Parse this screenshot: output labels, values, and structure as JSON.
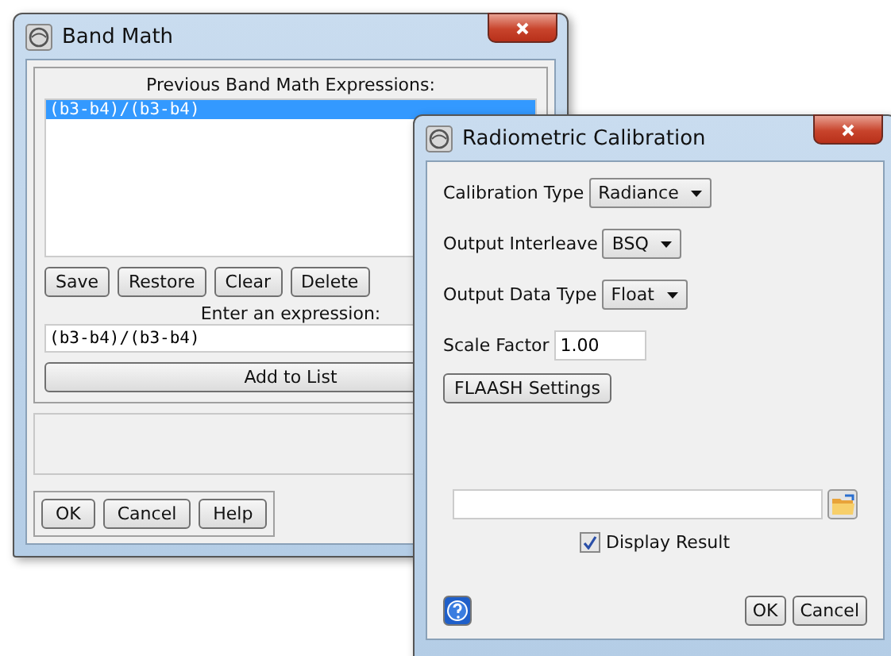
{
  "band_math": {
    "title": "Band Math",
    "list_label": "Previous Band Math Expressions:",
    "expressions": [
      {
        "text": "(b3-b4)/(b3-b4)",
        "selected": true
      }
    ],
    "list_buttons": [
      "Save",
      "Restore",
      "Clear",
      "Delete"
    ],
    "expression_label": "Enter an expression:",
    "expression_value": "(b3-b4)/(b3-b4)",
    "add_button": "Add to List",
    "buttons": [
      "OK",
      "Cancel",
      "Help"
    ]
  },
  "radiometric_calibration": {
    "title": "Radiometric Calibration",
    "fields": [
      {
        "kind": "dropdown",
        "label": "Calibration Type",
        "value": "Radiance"
      },
      {
        "kind": "dropdown",
        "label": "Output Interleave",
        "value": "BSQ"
      },
      {
        "kind": "dropdown",
        "label": "Output Data Type",
        "value": "Float"
      },
      {
        "kind": "text",
        "label": "Scale Factor",
        "value": "1.00"
      }
    ],
    "flaash_button": "FLAASH Settings",
    "display_result": {
      "label": "Display Result",
      "checked": true
    },
    "buttons": [
      "OK",
      "Cancel"
    ]
  }
}
